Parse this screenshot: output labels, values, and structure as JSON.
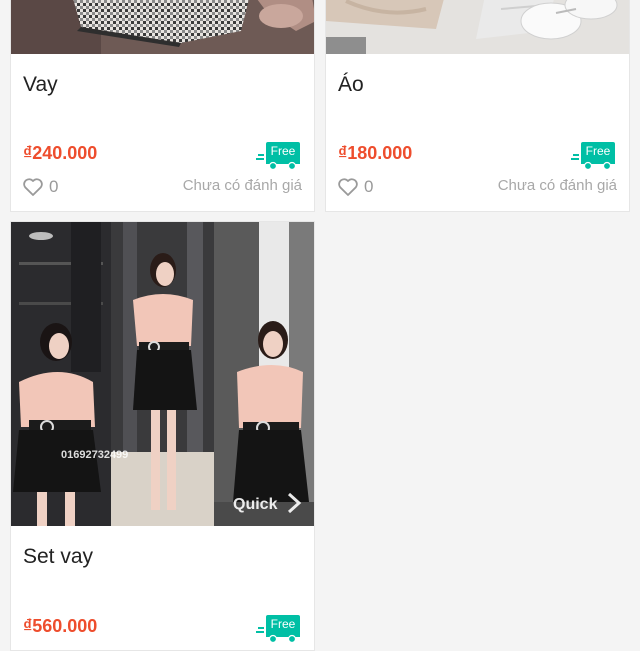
{
  "products": [
    {
      "title": "Vay",
      "price": "₫240.000",
      "shipping_badge": "Free",
      "likes": "0",
      "rating_text": "Chưa có đánh giá"
    },
    {
      "title": "Áo",
      "price": "₫180.000",
      "shipping_badge": "Free",
      "likes": "0",
      "rating_text": "Chưa có đánh giá"
    },
    {
      "title": "Set vay",
      "price": "₫560.000",
      "shipping_badge": "Free",
      "photo_watermark_phone": "01692732499",
      "photo_watermark_brand": "Quick"
    }
  ],
  "colors": {
    "price": "#ee4d2d",
    "free_badge": "#00bfa5",
    "muted_text": "#9a9a9a",
    "background": "#f4f4f4"
  },
  "icons": {
    "like": "heart-outline-icon",
    "shipping": "free-shipping-truck-icon"
  }
}
